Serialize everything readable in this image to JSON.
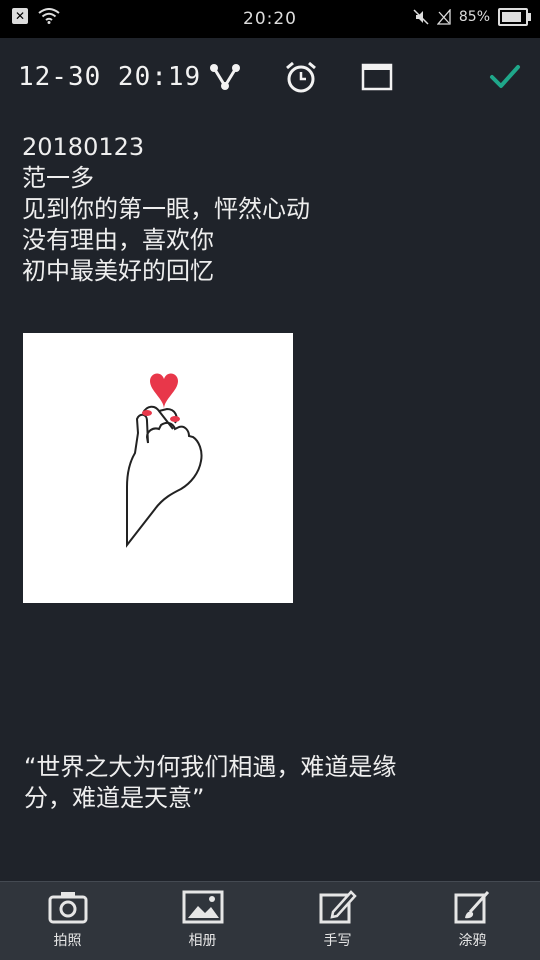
{
  "status_bar": {
    "time": "20:20",
    "battery_text": "85%",
    "battery_level": 0.85
  },
  "toolbar": {
    "datetime": "12-30 20:19",
    "icons": [
      "share-icon",
      "alarm-icon",
      "window-icon",
      "check-icon"
    ],
    "check_color": "#1fa78a"
  },
  "note": {
    "lines": [
      "20180123",
      "范一多",
      "见到你的第一眼，怦然心动",
      "没有理由，喜欢你",
      "初中最美好的回忆"
    ],
    "quote_lines": [
      "“世界之大为何我们相遇，难道是缘",
      "分，难道是天意”"
    ]
  },
  "bottom_bar": {
    "items": [
      {
        "label": "拍照",
        "icon": "camera-icon"
      },
      {
        "label": "相册",
        "icon": "gallery-icon"
      },
      {
        "label": "手写",
        "icon": "handwrite-icon"
      },
      {
        "label": "涂鸦",
        "icon": "doodle-icon"
      }
    ]
  },
  "colors": {
    "background": "#1f232a",
    "bottom_bar": "#30353c",
    "heart": "#e8374a"
  }
}
